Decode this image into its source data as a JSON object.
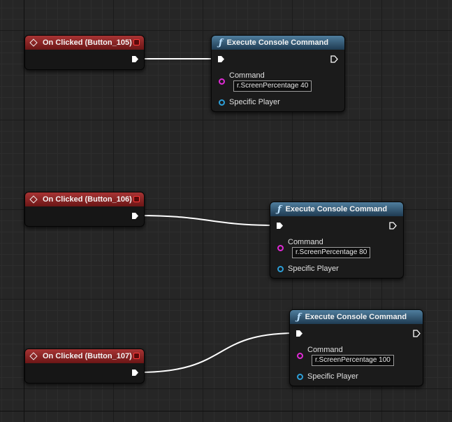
{
  "colors": {
    "event_header": "#a83434",
    "function_header": "#4f7e9e",
    "string_pin": "#e02ad6",
    "object_pin": "#2d9fd8",
    "exec_wire": "#ffffff"
  },
  "events": [
    {
      "title": "On Clicked (Button_105)"
    },
    {
      "title": "On Clicked (Button_106)"
    },
    {
      "title": "On Clicked (Button_107)"
    }
  ],
  "functions": [
    {
      "title": "Execute Console Command",
      "command_label": "Command",
      "command_value": "r.ScreenPercentage 40",
      "player_label": "Specific Player"
    },
    {
      "title": "Execute Console Command",
      "command_label": "Command",
      "command_value": "r.ScreenPercentage 80",
      "player_label": "Specific Player"
    },
    {
      "title": "Execute Console Command",
      "command_label": "Command",
      "command_value": "r.ScreenPercentage 100",
      "player_label": "Specific Player"
    }
  ],
  "icons": {
    "event": "event-diamond-icon",
    "function": "function-f-icon",
    "exec": "exec-pin-icon",
    "delegate": "delegate-pin-icon"
  }
}
